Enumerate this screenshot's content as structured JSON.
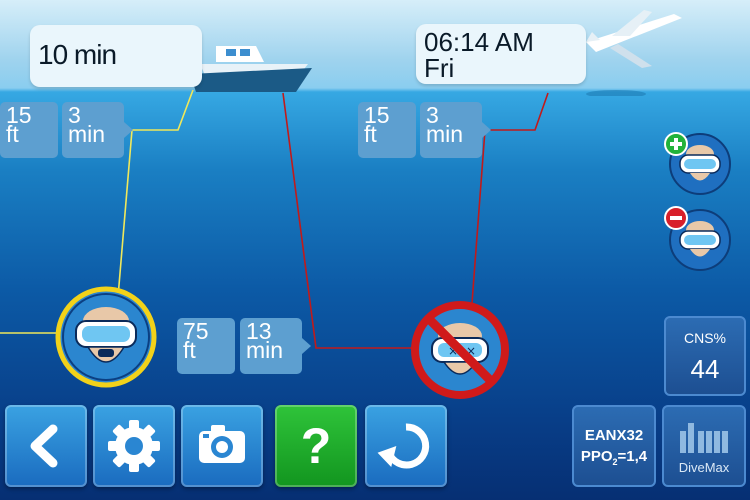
{
  "surface": {
    "dive_timer": "10 min",
    "clock_time": "06:14 AM",
    "clock_day": "Fri"
  },
  "stops": {
    "left": {
      "depth": "15",
      "depth_unit": "ft",
      "time": "3",
      "time_unit": "min"
    },
    "right": {
      "depth": "15",
      "depth_unit": "ft",
      "time": "3",
      "time_unit": "min"
    },
    "deep": {
      "depth": "75",
      "depth_unit": "ft",
      "time": "13",
      "time_unit": "min"
    }
  },
  "cns": {
    "label": "CNS%",
    "value": "44"
  },
  "gas": {
    "mix": "EANX32",
    "ppo2_prefix": "PPO",
    "ppo2_sub": "2",
    "ppo2_value": "=1,4"
  },
  "brand": {
    "name": "DiveMax"
  },
  "toolbar": {
    "help_glyph": "?"
  },
  "icons": {
    "back": "chevron-left-icon",
    "settings": "gear-icon",
    "camera": "camera-icon",
    "help": "question-icon",
    "reset": "refresh-icon",
    "add_diver": "plus-icon",
    "remove_diver": "minus-icon"
  },
  "colors": {
    "current_dive_line": "#f0e85a",
    "planned_dive_line": "#c11a1a",
    "active_diver_ring": "#f2d21a",
    "blocked_diver_ring": "#d01a1a",
    "help_button": "#1bb02a"
  }
}
